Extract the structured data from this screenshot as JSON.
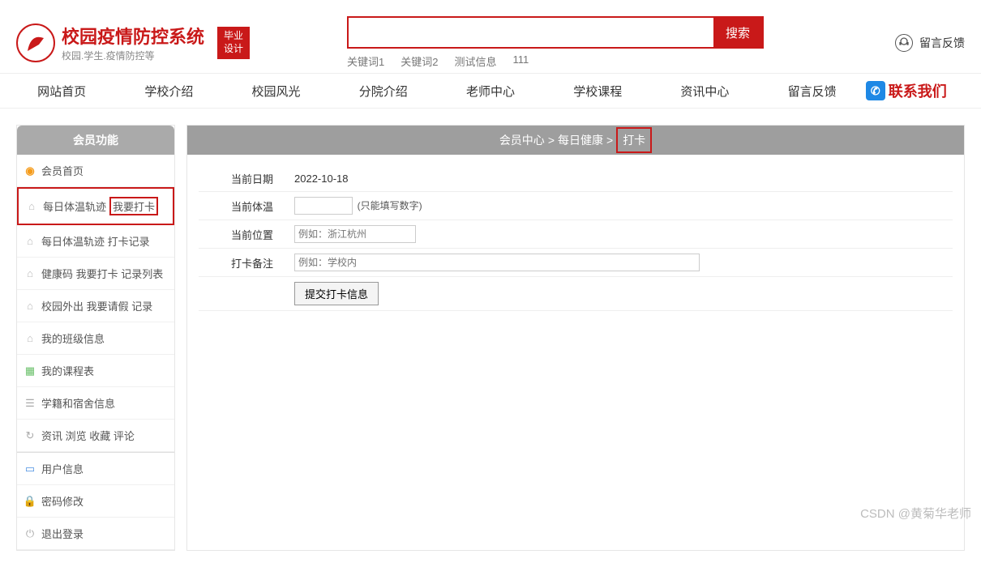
{
  "header": {
    "site_title": "校园疫情防控系统",
    "site_subtitle": "校园.学生.疫情防控等",
    "badge_line1": "毕业",
    "badge_line2": "设计",
    "search_button": "搜索",
    "keywords": [
      "关键词1",
      "关键词2",
      "测试信息",
      "111"
    ],
    "feedback_label": "留言反馈"
  },
  "nav": {
    "items": [
      "网站首页",
      "学校介绍",
      "校园风光",
      "分院介绍",
      "老师中心",
      "学校课程",
      "资讯中心",
      "留言反馈"
    ],
    "contact_label": "联系我们"
  },
  "sidebar": {
    "header": "会员功能",
    "home": "会员首页",
    "item1_a": "每日体温轨迹",
    "item1_b": "我要打卡",
    "item2": "每日体温轨迹 打卡记录",
    "item3": "健康码 我要打卡 记录列表",
    "item4": "校园外出 我要请假 记录",
    "item5": "我的班级信息",
    "item6": "我的课程表",
    "item7": "学籍和宿舍信息",
    "item8": "资讯 浏览 收藏 评论",
    "item9": "用户信息",
    "item10": "密码修改",
    "item11": "退出登录"
  },
  "breadcrumb": {
    "part1": "会员中心",
    "sep": ">",
    "part2": "每日健康",
    "part3": "打卡"
  },
  "form": {
    "rows": {
      "date_label": "当前日期",
      "date_value": "2022-10-18",
      "temp_label": "当前体温",
      "temp_hint": "(只能填写数字)",
      "loc_label": "当前位置",
      "loc_placeholder": "例如：浙江杭州",
      "note_label": "打卡备注",
      "note_placeholder": "例如：学校内"
    },
    "submit_label": "提交打卡信息"
  },
  "watermark": "CSDN @黄菊华老师"
}
